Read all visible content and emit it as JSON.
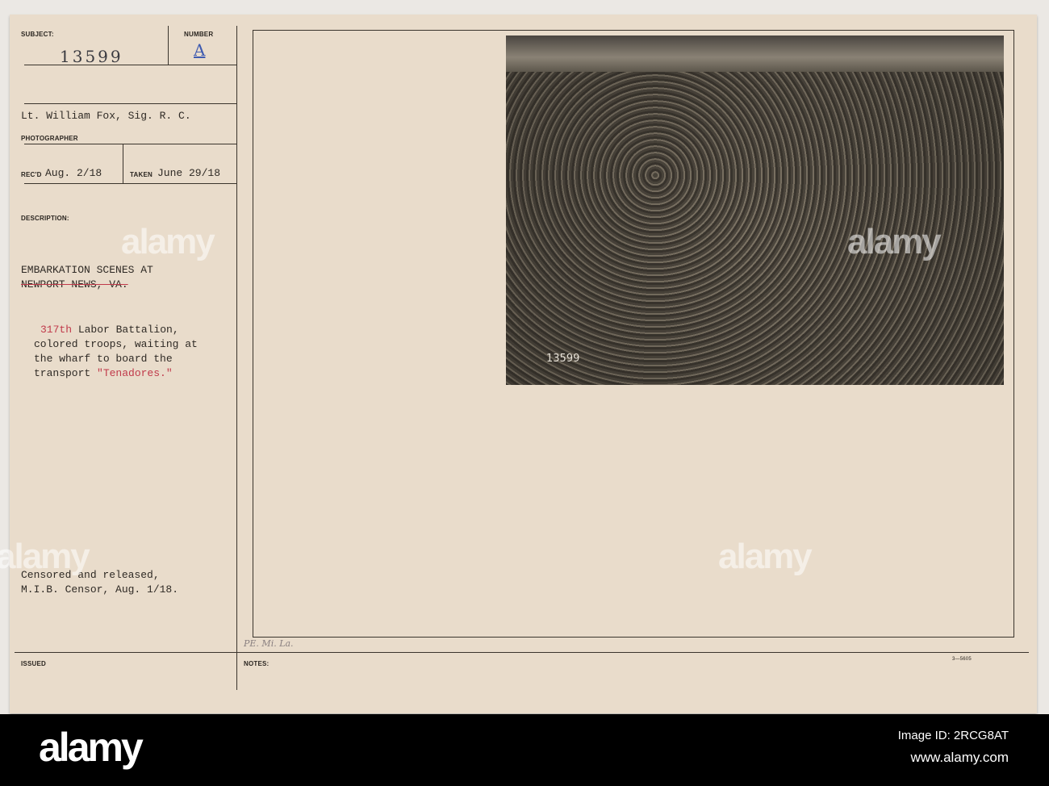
{
  "card": {
    "subject_label": "SUBJECT:",
    "subject_value": "13599",
    "number_label": "NUMBER",
    "number_value": "A",
    "photographer_value": "Lt. William Fox, Sig. R. C.",
    "photographer_label": "PHOTOGRAPHER",
    "recd_label": "REC'D",
    "recd_value": "Aug. 2/18",
    "taken_label": "TAKEN",
    "taken_value": "June 29/18",
    "description_label": "DESCRIPTION:",
    "title_line1": "EMBARKATION SCENES AT",
    "title_line2": "NEWPORT NEWS, VA.",
    "desc_lines": [
      "317th Labor Battalion,",
      "colored troops, waiting at",
      "the wharf to board the",
      "transport \"Tenadores.\""
    ],
    "desc_red_1": "317th",
    "desc_red_2": "\"Tenadores.\"",
    "censor_lines": [
      "Censored and released,",
      "M.I.B. Censor, Aug. 1/18."
    ],
    "initials": "PE. Mi. La.",
    "issued_label": "ISSUED",
    "notes_label": "NOTES:",
    "form_number": "3—5605",
    "photo_number": "13599"
  },
  "watermark": "alamy",
  "footer": {
    "logo": "alamy",
    "image_id": "Image ID: 2RCG8AT",
    "url": "www.alamy.com"
  }
}
